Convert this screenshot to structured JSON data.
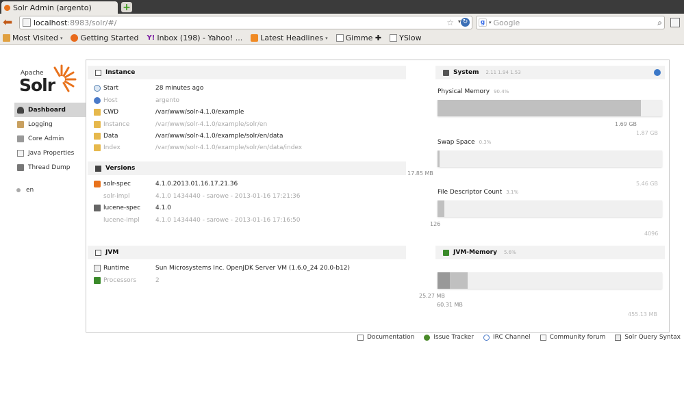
{
  "browser": {
    "tab_title": "Solr Admin (argento)",
    "new_tab_symbol": "+",
    "url_host": "localhost",
    "url_rest": ":8983/solr/#/",
    "search_placeholder": "Google",
    "search_engine_letter": "g"
  },
  "bookmarks": [
    {
      "label": "Most Visited",
      "icon": "folder-icon",
      "caret": "▾"
    },
    {
      "label": "Getting Started",
      "icon": "firefox-icon",
      "caret": ""
    },
    {
      "label": "Inbox (198) - Yahoo! ...",
      "icon": "yahoo-icon",
      "caret": ""
    },
    {
      "label": "Latest Headlines",
      "icon": "rss-icon",
      "caret": "▾"
    },
    {
      "label": "Gimme ✚",
      "icon": "page-icon",
      "caret": ""
    },
    {
      "label": "YSlow",
      "icon": "page-icon",
      "caret": ""
    }
  ],
  "logo": {
    "apache": "Apache",
    "solr": "Solr"
  },
  "sidebar": [
    {
      "label": "Dashboard",
      "icon": "dashboard-icon",
      "active": true
    },
    {
      "label": "Logging",
      "icon": "logging-icon",
      "active": false
    },
    {
      "label": "Core Admin",
      "icon": "core-admin-icon",
      "active": false
    },
    {
      "label": "Java Properties",
      "icon": "java-properties-icon",
      "active": false
    },
    {
      "label": "Thread Dump",
      "icon": "thread-dump-icon",
      "active": false
    }
  ],
  "core_selector": {
    "label": "en"
  },
  "instance": {
    "title": "Instance",
    "rows": [
      {
        "label": "Start",
        "value": "28 minutes ago"
      },
      {
        "label": "Host",
        "value": "argento"
      },
      {
        "label": "CWD",
        "value": "/var/www/solr-4.1.0/example"
      },
      {
        "label": "Instance",
        "value": "/var/www/solr-4.1.0/example/solr/en"
      },
      {
        "label": "Data",
        "value": "/var/www/solr-4.1.0/example/solr/en/data"
      },
      {
        "label": "Index",
        "value": "/var/www/solr-4.1.0/example/solr/en/data/index"
      }
    ]
  },
  "versions": {
    "title": "Versions",
    "rows": [
      {
        "label": "solr-spec",
        "value": "4.1.0.2013.01.16.17.21.36"
      },
      {
        "label": "solr-impl",
        "value": "4.1.0 1434440 - sarowe - 2013-01-16 17:21:36"
      },
      {
        "label": "lucene-spec",
        "value": "4.1.0"
      },
      {
        "label": "lucene-impl",
        "value": "4.1.0 1434440 - sarowe - 2013-01-16 17:16:50"
      }
    ]
  },
  "jvm": {
    "title": "JVM",
    "rows": [
      {
        "label": "Runtime",
        "value": "Sun Microsystems Inc. OpenJDK Server VM (1.6.0_24 20.0-b12)"
      },
      {
        "label": "Processors",
        "value": "2"
      }
    ]
  },
  "system": {
    "title": "System",
    "load": "2.11  1.94  1.53",
    "physical_memory": {
      "title": "Physical Memory",
      "percent": "90.4%",
      "fraction": 0.904,
      "used": "1.69 GB",
      "total": "1.87 GB"
    },
    "swap_space": {
      "title": "Swap Space",
      "percent": "0.3%",
      "fraction": 0.003,
      "used": "17.85 MB",
      "total": "5.46 GB"
    },
    "file_descriptors": {
      "title": "File Descriptor Count",
      "percent": "3.1%",
      "fraction": 0.031,
      "used": "126",
      "total": "4096"
    }
  },
  "jvm_memory": {
    "title": "JVM-Memory",
    "percent": "5.6%",
    "used_fraction": 0.056,
    "committed_fraction": 0.133,
    "used": "25.27 MB",
    "committed": "60.31 MB",
    "max": "455.13 MB"
  },
  "footer": [
    {
      "label": "Documentation",
      "icon": "documentation-icon"
    },
    {
      "label": "Issue Tracker",
      "icon": "bug-icon"
    },
    {
      "label": "IRC Channel",
      "icon": "irc-icon"
    },
    {
      "label": "Community forum",
      "icon": "mail-icon"
    },
    {
      "label": "Solr Query Syntax",
      "icon": "query-syntax-icon"
    }
  ]
}
